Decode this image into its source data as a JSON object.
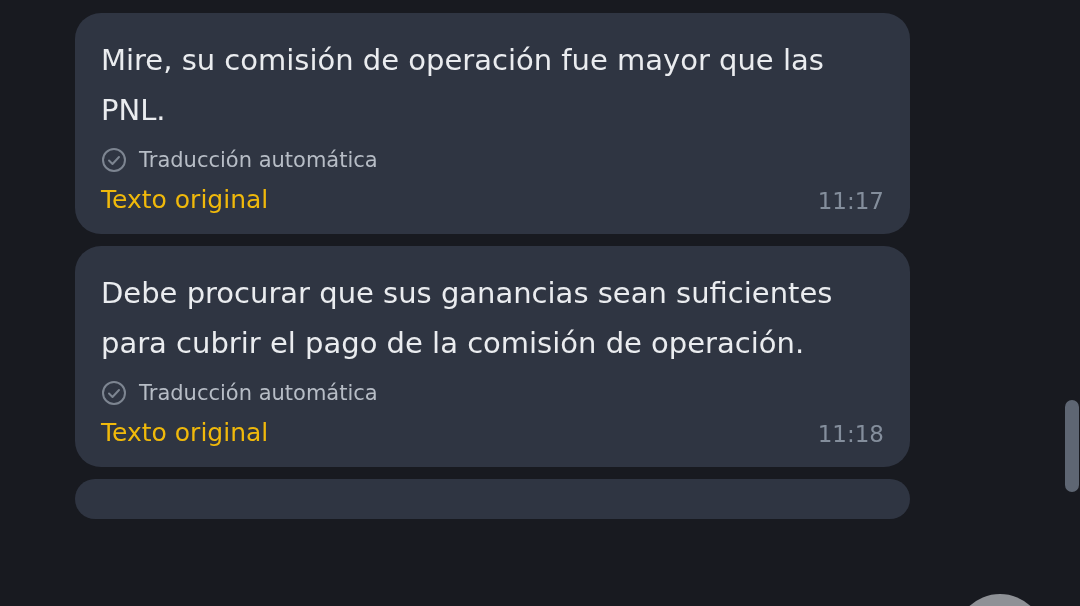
{
  "messages": [
    {
      "text": "Mire, su comisión de operación fue mayor que las PNL.",
      "translation_label": "Traducción automática",
      "original_link": "Texto original",
      "time": "11:17"
    },
    {
      "text": "Debe procurar que sus ganancias sean suficientes para cubrir el pago de la comisión de operación.",
      "translation_label": "Traducción automática",
      "original_link": "Texto original",
      "time": "11:18"
    }
  ]
}
